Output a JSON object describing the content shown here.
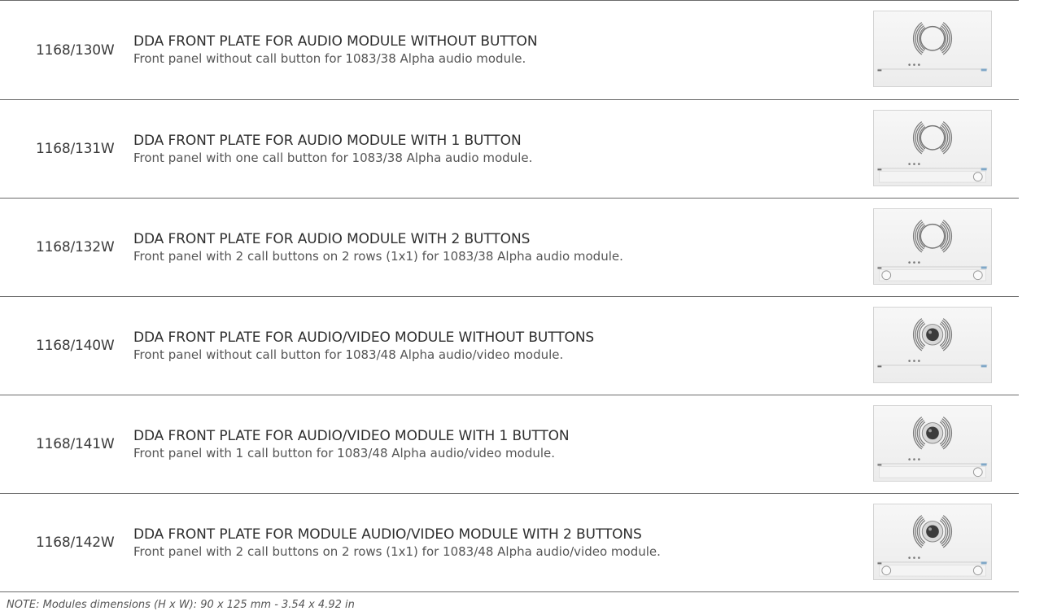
{
  "products": [
    {
      "code": "1168/130W",
      "title": "DDA FRONT PLATE FOR AUDIO MODULE WITHOUT BUTTON",
      "description": "Front panel without call button for 1083/38 Alpha audio module.",
      "image": {
        "type": "audio",
        "buttons": 0
      }
    },
    {
      "code": "1168/131W",
      "title": "DDA FRONT PLATE FOR AUDIO MODULE WITH 1 BUTTON",
      "description": "Front panel with one call button for 1083/38 Alpha audio module.",
      "image": {
        "type": "audio",
        "buttons": 1
      }
    },
    {
      "code": "1168/132W",
      "title": "DDA FRONT PLATE FOR AUDIO MODULE WITH 2 BUTTONS",
      "description": "Front panel with 2 call buttons on 2 rows (1x1) for 1083/38 Alpha audio module.",
      "image": {
        "type": "audio",
        "buttons": 2
      }
    },
    {
      "code": "1168/140W",
      "title": "DDA FRONT PLATE FOR AUDIO/VIDEO MODULE WITHOUT BUTTONS",
      "description": "Front panel without call button for 1083/48 Alpha audio/video module.",
      "image": {
        "type": "video",
        "buttons": 0
      }
    },
    {
      "code": "1168/141W",
      "title": "DDA FRONT PLATE FOR AUDIO/VIDEO MODULE WITH 1 BUTTON",
      "description": "Front panel with 1 call button for 1083/48 Alpha audio/video module.",
      "image": {
        "type": "video",
        "buttons": 1
      }
    },
    {
      "code": "1168/142W",
      "title": "DDA FRONT PLATE FOR MODULE AUDIO/VIDEO MODULE WITH 2 BUTTONS",
      "description": "Front panel with 2 call buttons on 2 rows (1x1) for 1083/48 Alpha audio/video module.",
      "image": {
        "type": "video",
        "buttons": 2
      }
    }
  ],
  "note": "NOTE: Modules dimensions (H x W): 90 x 125 mm - 3.54 x 4.92 in"
}
